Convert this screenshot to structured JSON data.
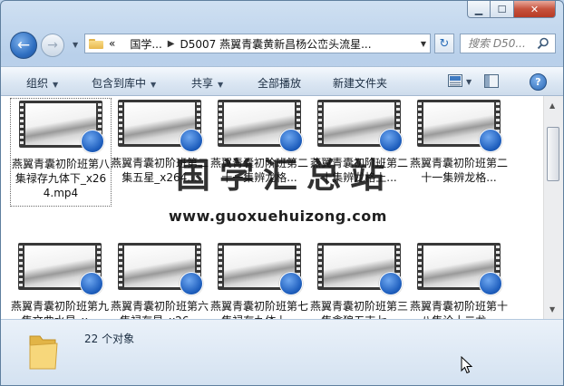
{
  "window": {
    "caption": {
      "minimize": "▁",
      "maximize": "☐",
      "close": "✕"
    }
  },
  "nav": {
    "back_glyph": "←",
    "forward_glyph": "→",
    "breadcrumb": [
      "国学...",
      "D5007 燕翼青囊黄新昌杨公峦头流星..."
    ],
    "breadcrumb_prefix": "«",
    "refresh_glyph": "↻",
    "search_placeholder": "搜索 D50..."
  },
  "toolbar": {
    "items": [
      "组织",
      "包含到库中",
      "共享",
      "全部播放",
      "新建文件夹"
    ]
  },
  "files": {
    "row1": [
      {
        "name": "燕翼青囊初阶班第八集禄存九体下_x264.mp4"
      },
      {
        "name": "燕翼青囊初阶班第二集五星_x264..."
      },
      {
        "name": "燕翼青囊初阶班第二十一集辨龙格..."
      },
      {
        "name": "燕翼青囊初阶班第二十集辨龙格上..."
      },
      {
        "name": "燕翼青囊初阶班第二十一集辨龙格..."
      }
    ],
    "row2": [
      {
        "name": "燕翼青囊初阶班第九集文曲水星_x..."
      },
      {
        "name": "燕翼青囊初阶班第六集禄存星_x26..."
      },
      {
        "name": "燕翼青囊初阶班第七集禄存九体上..."
      },
      {
        "name": "燕翼青囊初阶班第三集贪狼五吉七..."
      },
      {
        "name": "燕翼青囊初阶班第十八集论十二龙..."
      }
    ]
  },
  "watermark": {
    "title": "国学汇总站",
    "url": "www.guoxuehuizong.com"
  },
  "status": {
    "count_text": "22 个对象"
  },
  "colors": {
    "accent": "#2f6fc1",
    "titlebar": "#b9d0ea",
    "close": "#c6523d"
  }
}
